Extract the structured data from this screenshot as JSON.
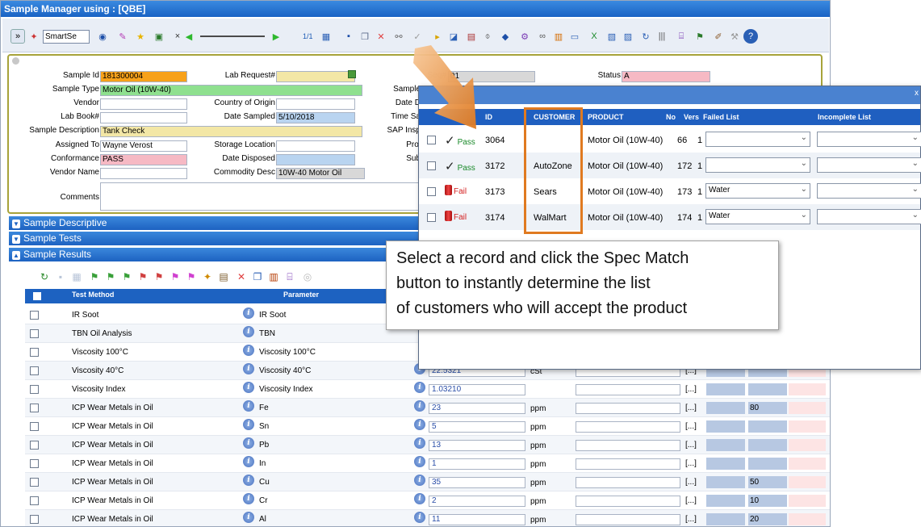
{
  "window": {
    "title": "Sample Manager using : [QBE]"
  },
  "toolbar": {
    "smart_search_value": "SmartSe",
    "pager": "1/1"
  },
  "form": {
    "sample_id": {
      "label": "Sample Id",
      "value": "181300004"
    },
    "sample_type": {
      "label": "Sample Type",
      "value": "Motor Oil (10W-40)"
    },
    "vendor": {
      "label": "Vendor",
      "value": ""
    },
    "lab_book": {
      "label": "Lab Book#",
      "value": ""
    },
    "sample_description": {
      "label": "Sample Description",
      "value": "Tank Check"
    },
    "assigned_to": {
      "label": "Assigned To",
      "value": "Wayne Verost"
    },
    "conformance": {
      "label": "Conformance",
      "value": "PASS"
    },
    "vendor_name": {
      "label": "Vendor Name",
      "value": ""
    },
    "comments": {
      "label": "Comments",
      "value": ""
    },
    "lab_request": {
      "label": "Lab Request#",
      "value": ""
    },
    "country_of_origin": {
      "label": "Country of Origin",
      "value": ""
    },
    "date_sampled": {
      "label": "Date Sampled",
      "value": "5/10/2018"
    },
    "storage_location": {
      "label": "Storage Location",
      "value": ""
    },
    "date_disposed": {
      "label": "Date Disposed",
      "value": ""
    },
    "commodity_desc": {
      "label": "Commodity Desc",
      "value": "10W-40 Motor Oil"
    },
    "seq": {
      "label": "Seq#",
      "value": "01"
    },
    "status": {
      "label": "Status",
      "value": "A"
    },
    "partial_labels": [
      "Sample",
      "Date D",
      "Time Sa",
      "SAP Insp",
      "Proj",
      "Sub"
    ]
  },
  "sections": {
    "descriptive": "Sample Descriptive",
    "tests": "Sample Tests",
    "results": "Sample Results"
  },
  "results_table": {
    "headers": {
      "test_method": "Test Method",
      "parameter": "Parameter"
    },
    "rows": [
      {
        "method": "IR Soot",
        "parameter": "IR Soot",
        "value": null,
        "unit": "",
        "b2": ""
      },
      {
        "method": "TBN Oil Analysis",
        "parameter": "TBN",
        "value": null,
        "unit": "",
        "b2": ""
      },
      {
        "method": "Viscosity 100°C",
        "parameter": "Viscosity 100°C",
        "value": null,
        "unit": "",
        "b2": ""
      },
      {
        "method": "Viscosity 40°C",
        "parameter": "Viscosity 40°C",
        "value": "22.5321",
        "unit": "cSt",
        "b2": ""
      },
      {
        "method": "Viscosity Index",
        "parameter": "Viscosity Index",
        "value": "1.03210",
        "unit": "",
        "b2": ""
      },
      {
        "method": "ICP Wear Metals in Oil",
        "parameter": "Fe",
        "value": "23",
        "unit": "ppm",
        "b2": "80"
      },
      {
        "method": "ICP Wear Metals in Oil",
        "parameter": "Sn",
        "value": "5",
        "unit": "ppm",
        "b2": ""
      },
      {
        "method": "ICP Wear Metals in Oil",
        "parameter": "Pb",
        "value": "13",
        "unit": "ppm",
        "b2": ""
      },
      {
        "method": "ICP Wear Metals in Oil",
        "parameter": "In",
        "value": "1",
        "unit": "ppm",
        "b2": ""
      },
      {
        "method": "ICP Wear Metals in Oil",
        "parameter": "Cu",
        "value": "35",
        "unit": "ppm",
        "b2": "50"
      },
      {
        "method": "ICP Wear Metals in Oil",
        "parameter": "Cr",
        "value": "2",
        "unit": "ppm",
        "b2": "10"
      },
      {
        "method": "ICP Wear Metals in Oil",
        "parameter": "Al",
        "value": "11",
        "unit": "ppm",
        "b2": "20"
      }
    ],
    "dots": "[...]"
  },
  "spec_match": {
    "close": "x",
    "headers": {
      "id": "ID",
      "customer": "CUSTOMER",
      "product": "PRODUCT",
      "no": "No",
      "vers": "Vers",
      "failed_list": "Failed List",
      "incomplete_list": "Incomplete List"
    },
    "rows": [
      {
        "status": "Pass",
        "id": "3064",
        "customer": "",
        "product": "Motor Oil (10W-40)",
        "no": "66",
        "vers": "1",
        "failed": ""
      },
      {
        "status": "Pass",
        "id": "3172",
        "customer": "AutoZone",
        "product": "Motor Oil (10W-40)",
        "no": "172",
        "vers": "1",
        "failed": ""
      },
      {
        "status": "Fail",
        "id": "3173",
        "customer": "Sears",
        "product": "Motor Oil (10W-40)",
        "no": "173",
        "vers": "1",
        "failed": "Water"
      },
      {
        "status": "Fail",
        "id": "3174",
        "customer": "WalMart",
        "product": "Motor Oil (10W-40)",
        "no": "174",
        "vers": "1",
        "failed": "Water"
      }
    ]
  },
  "callout": {
    "line1": "Select a record and click the Spec Match",
    "line2": "button to instantly determine the list",
    "line3": "of customers who will accept the product"
  },
  "colors": {
    "title_blue": "#1a63c4",
    "highlight_orange": "#e07a20",
    "pass_green": "#1a8a2a",
    "fail_red": "#d42020",
    "field_orange": "#f7a11a",
    "field_green": "#8fe08f",
    "field_pink": "#f6b9c4",
    "field_blue": "#b9d4f0",
    "field_tan": "#f3e7a6"
  }
}
